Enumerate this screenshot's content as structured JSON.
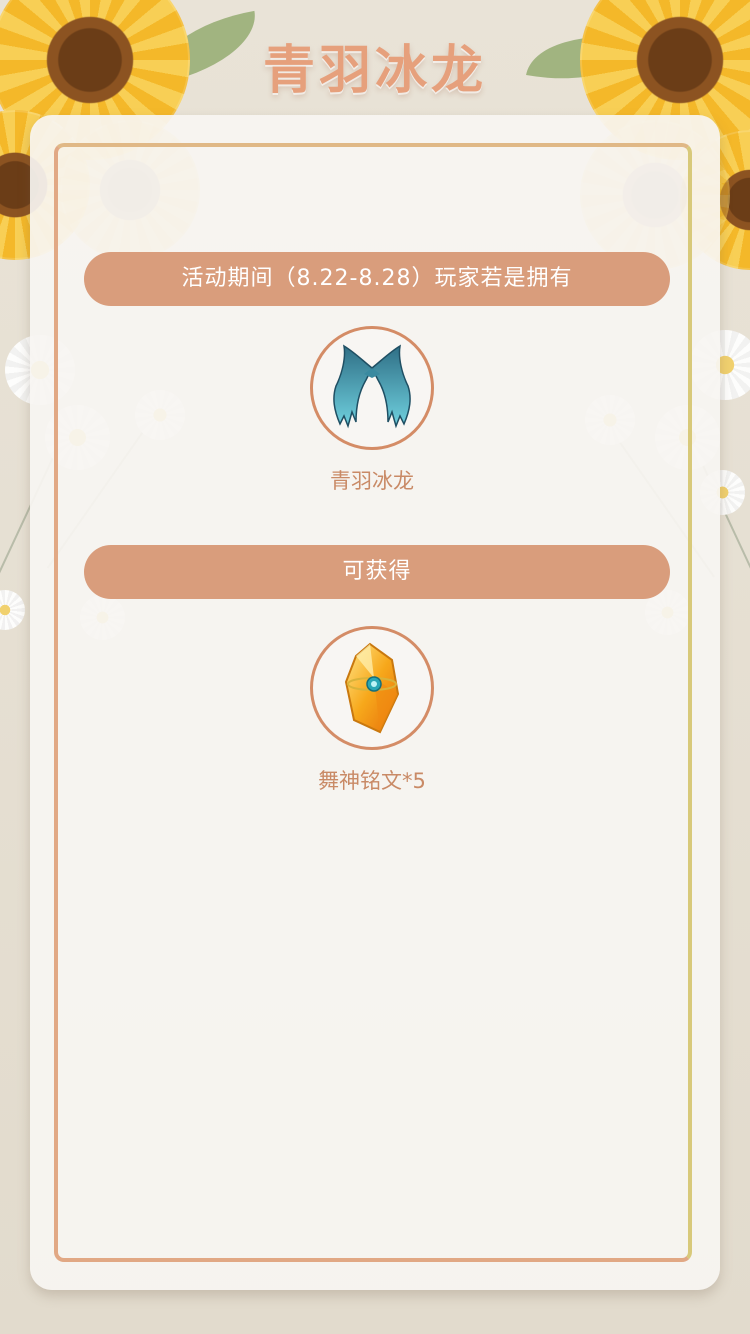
{
  "header": {
    "title": "青羽冰龙"
  },
  "content": {
    "condition_banner": "活动期间（8.22-8.28）玩家若是拥有",
    "required_item": {
      "name": "青羽冰龙",
      "icon": "wings-icon"
    },
    "reward_banner": "可获得",
    "reward_item": {
      "name": "舞神铭文*5",
      "icon": "crystal-inscription-icon"
    }
  },
  "colors": {
    "accent": "#d99d7c",
    "title": "#e6a07c",
    "label": "#c98a66",
    "background": "#e8e1d4"
  }
}
